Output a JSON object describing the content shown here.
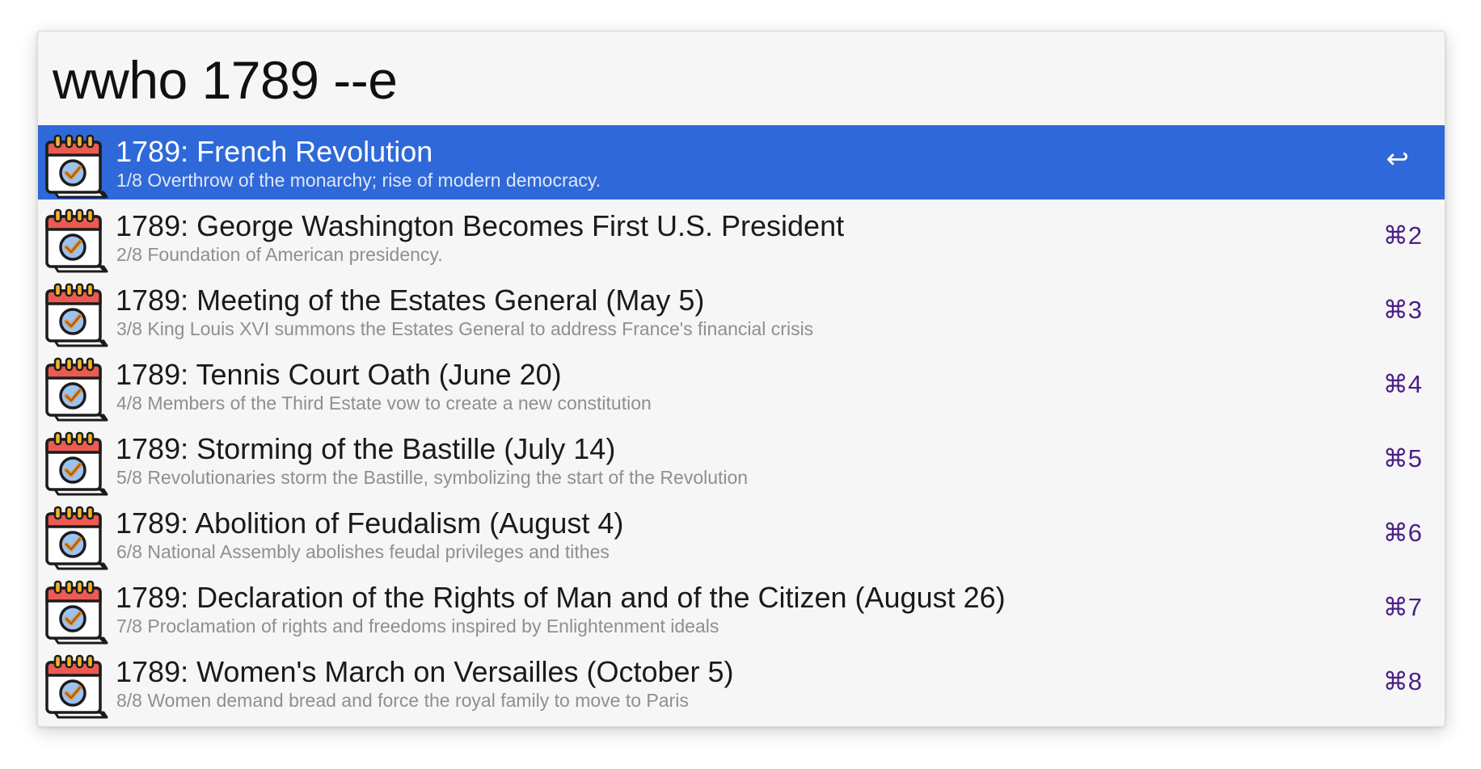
{
  "search": {
    "query": "wwho 1789 --e"
  },
  "results": [
    {
      "title": "1789: French Revolution",
      "subtitle": "1/8 Overthrow of the monarchy; rise of modern democracy.",
      "shortcut": "↩",
      "selected": true
    },
    {
      "title": "1789: George Washington Becomes First U.S. President",
      "subtitle": "2/8 Foundation of American presidency.",
      "shortcut": "⌘2"
    },
    {
      "title": "1789: Meeting of the Estates General (May 5)",
      "subtitle": "3/8 King Louis XVI summons the Estates General to address France's financial crisis",
      "shortcut": "⌘3"
    },
    {
      "title": "1789: Tennis Court Oath (June 20)",
      "subtitle": "4/8 Members of the Third Estate vow to create a new constitution",
      "shortcut": "⌘4"
    },
    {
      "title": "1789: Storming of the Bastille (July 14)",
      "subtitle": "5/8 Revolutionaries storm the Bastille, symbolizing the start of the Revolution",
      "shortcut": "⌘5"
    },
    {
      "title": "1789: Abolition of Feudalism (August 4)",
      "subtitle": "6/8 National Assembly abolishes feudal privileges and tithes",
      "shortcut": "⌘6"
    },
    {
      "title": "1789: Declaration of the Rights of Man and of the Citizen (August 26)",
      "subtitle": "7/8 Proclamation of rights and freedoms inspired by Enlightenment ideals",
      "shortcut": "⌘7"
    },
    {
      "title": "1789: Women's March on Versailles (October 5)",
      "subtitle": "8/8 Women demand bread and force the royal family to move to Paris",
      "shortcut": "⌘8"
    }
  ],
  "icon": {
    "name": "calendar-check-icon",
    "colors": {
      "header": "#ec5b52",
      "rings": "#f2b431",
      "page": "#ffffff",
      "outline": "#1c1c1c",
      "badge": "#9cc2f0",
      "check": "#e88a1e"
    }
  },
  "colors": {
    "selection": "#2f69d9",
    "shortcut": "#4a1f86",
    "subtitle": "#8f8f8f"
  }
}
